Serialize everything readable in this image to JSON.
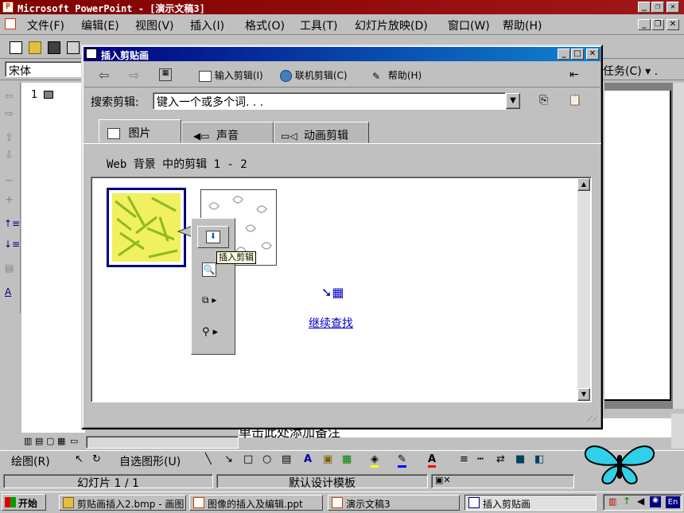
{
  "app": {
    "title": "Microsoft PowerPoint - [演示文稿3]",
    "menu": [
      "文件(F)",
      "编辑(E)",
      "视图(V)",
      "插入(I)",
      "格式(O)",
      "工具(T)",
      "幻灯片放映(D)",
      "窗口(W)",
      "帮助(H)"
    ],
    "font_name": "宋体",
    "task_pane_label": "任务(C)",
    "slide_number": "1",
    "notes_placeholder": "单击此处添加备注",
    "draw_menu": "绘图(R)",
    "autoshapes_menu": "自选图形(U)",
    "status": {
      "slide": "幻灯片 1 / 1",
      "template": "默认设计模板"
    }
  },
  "dialog": {
    "title": "插入剪贴画",
    "toolbar": {
      "import": "输入剪辑(I)",
      "online": "联机剪辑(C)",
      "help": "帮助(H)"
    },
    "search_label": "搜索剪辑:",
    "search_value": "键入一个或多个词. . .",
    "tabs": [
      "图片",
      "声音",
      "动画剪辑"
    ],
    "results_header": "Web 背景 中的剪辑 1 - 2",
    "tooltip": "插入剪辑",
    "continue_search": "继续查找"
  },
  "taskbar": {
    "start": "开始",
    "items": [
      "剪贴画插入2.bmp - 画图",
      "图像的插入及编辑.ppt",
      "演示文稿3",
      "插入剪贴画"
    ],
    "tray_text": "En"
  },
  "colors": {
    "app_title": "#800000",
    "dialog_title": "#000080",
    "link": "#0000cc"
  }
}
